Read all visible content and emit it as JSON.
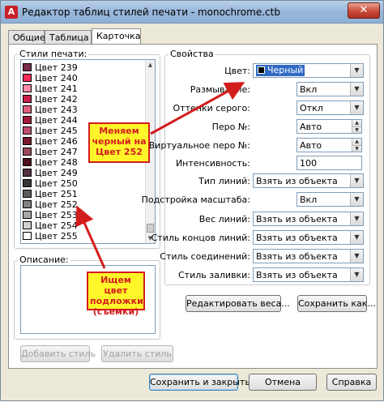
{
  "window": {
    "title": "Редактор таблиц стилей печати - monochrome.ctb",
    "app_icon_letter": "A",
    "close_glyph": "✕"
  },
  "tabs": [
    {
      "label": "Общие"
    },
    {
      "label": "Таблица"
    },
    {
      "label": "Карточка"
    }
  ],
  "styles": {
    "label": "Стили печати:",
    "items": [
      {
        "label": "Цвет 239",
        "color": "#7a2a4a"
      },
      {
        "label": "Цвет 240",
        "color": "#ff2a5a"
      },
      {
        "label": "Цвет 241",
        "color": "#ff8aa8"
      },
      {
        "label": "Цвет 242",
        "color": "#cc1f4a"
      },
      {
        "label": "Цвет 243",
        "color": "#e06080"
      },
      {
        "label": "Цвет 244",
        "color": "#a31a3c"
      },
      {
        "label": "Цвет 245",
        "color": "#c04e6e"
      },
      {
        "label": "Цвет 246",
        "color": "#7c1a30"
      },
      {
        "label": "Цвет 247",
        "color": "#9a4a5c"
      },
      {
        "label": "Цвет 248",
        "color": "#4e1020"
      },
      {
        "label": "Цвет 249",
        "color": "#503040"
      },
      {
        "label": "Цвет 250",
        "color": "#353535"
      },
      {
        "label": "Цвет 251",
        "color": "#5a5a5a"
      },
      {
        "label": "Цвет 252",
        "color": "#808080"
      },
      {
        "label": "Цвет 253",
        "color": "#a8a8a8"
      },
      {
        "label": "Цвет 254",
        "color": "#d2d2d2"
      },
      {
        "label": "Цвет 255",
        "color": "#ffffff"
      }
    ]
  },
  "description": {
    "label": "Описание:"
  },
  "buttons": {
    "add_style": "Добавить стиль",
    "delete_style": "Удалить стиль",
    "edit_weights": "Редактировать веса...",
    "save_as": "Сохранить как...",
    "save_close": "Сохранить и закрыть",
    "cancel": "Отмена",
    "help": "Справка"
  },
  "properties": {
    "label": "Свойства",
    "color": {
      "label": "Цвет:",
      "value": "Черный"
    },
    "dithering": {
      "label": "Размывание:",
      "value": "Вкл"
    },
    "grayscale": {
      "label": "Оттенки серого:",
      "value": "Откл"
    },
    "pen": {
      "label": "Перо №:",
      "value": "Авто"
    },
    "virtual_pen": {
      "label": "Виртуальное перо №:",
      "value": "Авто"
    },
    "intensity": {
      "label": "Интенсивность:",
      "value": "100"
    },
    "linetype": {
      "label": "Тип линий:",
      "value": "Взять из объекта"
    },
    "adaptive": {
      "label": "Подстройка масштаба:",
      "value": "Вкл"
    },
    "lineweight": {
      "label": "Вес линий:",
      "value": "Взять из объекта"
    },
    "line_end": {
      "label": "Стиль концов линий:",
      "value": "Взять из объекта"
    },
    "line_join": {
      "label": "Стиль соединений:",
      "value": "Взять из объекта"
    },
    "fill": {
      "label": "Стиль заливки:",
      "value": "Взять из объекта"
    }
  },
  "annotations": {
    "callout_change_black": "Меняем черный на Цвет 252",
    "callout_find_color": "Ищем цвет подложки (съемки)"
  },
  "colors": {
    "callout_fill": "#fff62a",
    "callout_border": "#d21d1d",
    "selection": "#316ac5"
  }
}
